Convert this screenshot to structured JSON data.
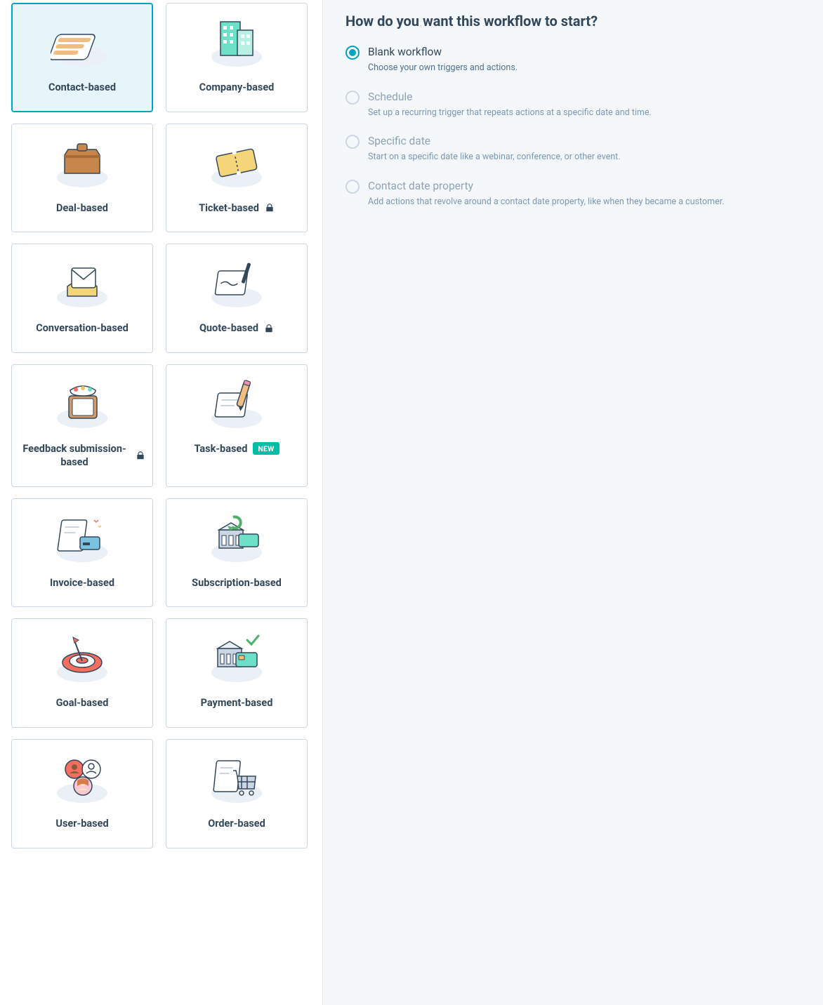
{
  "panel": {
    "title": "How do you want this workflow to start?",
    "options": [
      {
        "id": "blank",
        "label": "Blank workflow",
        "desc": "Choose your own triggers and actions.",
        "selected": true,
        "disabled": false
      },
      {
        "id": "schedule",
        "label": "Schedule",
        "desc": "Set up a recurring trigger that repeats actions at a specific date and time.",
        "selected": false,
        "disabled": true
      },
      {
        "id": "specific-date",
        "label": "Specific date",
        "desc": "Start on a specific date like a webinar, conference, or other event.",
        "selected": false,
        "disabled": true
      },
      {
        "id": "contact-date",
        "label": "Contact date property",
        "desc": "Add actions that revolve around a contact date property, like when they became a customer.",
        "selected": false,
        "disabled": true
      }
    ]
  },
  "cards": [
    {
      "id": "contact",
      "label": "Contact-based",
      "selected": true,
      "locked": false,
      "badge": null,
      "icon": "contacts-icon"
    },
    {
      "id": "company",
      "label": "Company-based",
      "selected": false,
      "locked": false,
      "badge": null,
      "icon": "company-icon"
    },
    {
      "id": "deal",
      "label": "Deal-based",
      "selected": false,
      "locked": false,
      "badge": null,
      "icon": "deal-icon"
    },
    {
      "id": "ticket",
      "label": "Ticket-based",
      "selected": false,
      "locked": true,
      "badge": null,
      "icon": "ticket-icon"
    },
    {
      "id": "conversation",
      "label": "Conversation-based",
      "selected": false,
      "locked": false,
      "badge": null,
      "icon": "conversation-icon"
    },
    {
      "id": "quote",
      "label": "Quote-based",
      "selected": false,
      "locked": true,
      "badge": null,
      "icon": "quote-icon"
    },
    {
      "id": "feedback",
      "label": "Feedback submission-based",
      "selected": false,
      "locked": true,
      "badge": null,
      "icon": "feedback-icon"
    },
    {
      "id": "task",
      "label": "Task-based",
      "selected": false,
      "locked": false,
      "badge": "NEW",
      "icon": "task-icon"
    },
    {
      "id": "invoice",
      "label": "Invoice-based",
      "selected": false,
      "locked": false,
      "badge": null,
      "icon": "invoice-icon"
    },
    {
      "id": "subscription",
      "label": "Subscription-based",
      "selected": false,
      "locked": false,
      "badge": null,
      "icon": "subscription-icon"
    },
    {
      "id": "goal",
      "label": "Goal-based",
      "selected": false,
      "locked": false,
      "badge": null,
      "icon": "goal-icon"
    },
    {
      "id": "payment",
      "label": "Payment-based",
      "selected": false,
      "locked": false,
      "badge": null,
      "icon": "payment-icon"
    },
    {
      "id": "user",
      "label": "User-based",
      "selected": false,
      "locked": false,
      "badge": null,
      "icon": "user-icon"
    },
    {
      "id": "order",
      "label": "Order-based",
      "selected": false,
      "locked": false,
      "badge": null,
      "icon": "order-icon"
    }
  ],
  "colors": {
    "accent": "#00a4bd",
    "text": "#33475b",
    "muted": "#7c98b6",
    "border": "#cbd6e2",
    "bgRight": "#f5f8fa",
    "selectedBg": "#e5f5f8",
    "badgeBg": "#00bda5"
  }
}
